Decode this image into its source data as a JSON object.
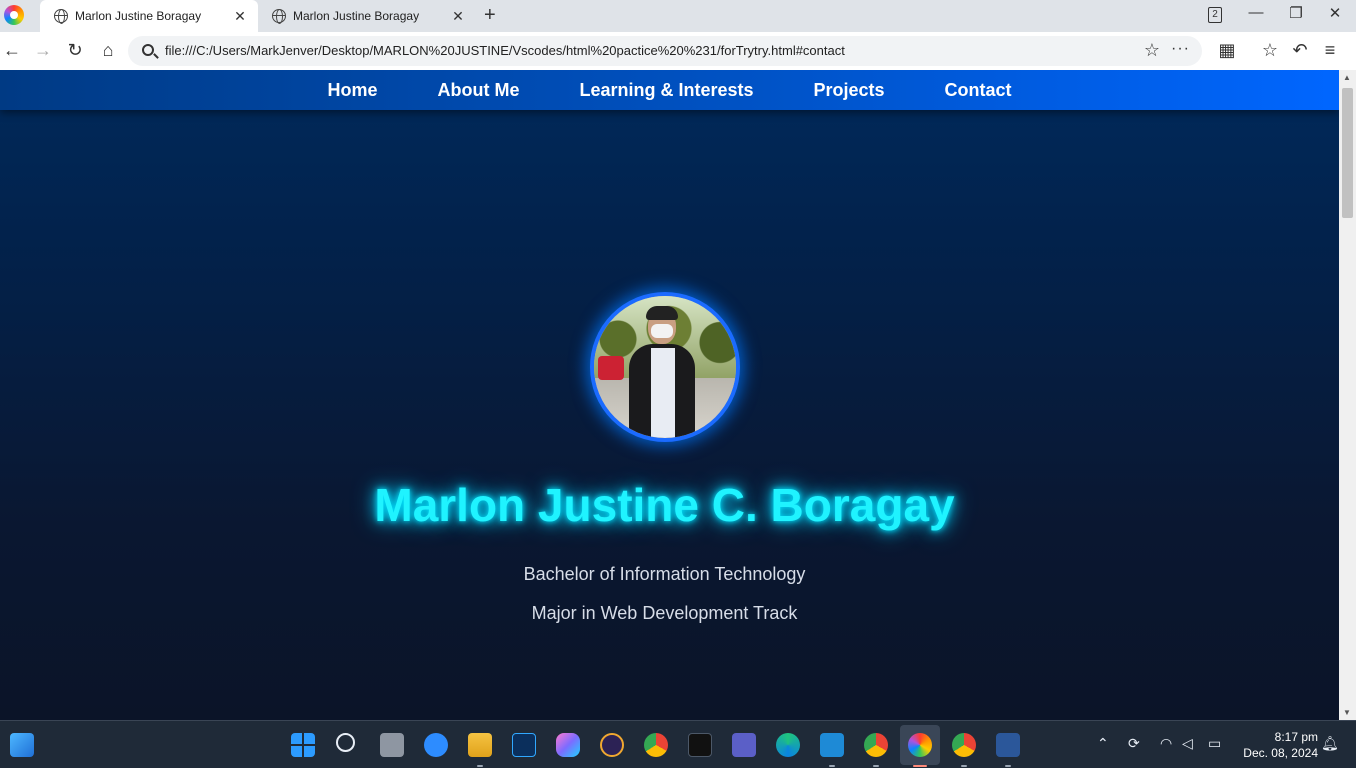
{
  "browser": {
    "tabs": [
      {
        "title": "Marlon Justine Boragay",
        "active": true
      },
      {
        "title": "Marlon Justine Boragay",
        "active": false
      }
    ],
    "tab_count": "2",
    "url": "file:///C:/Users/MarkJenver/Desktop/MARLON%20JUSTINE/Vscodes/html%20pactice%20%231/forTrytry.html#contact",
    "icons": {
      "back": "←",
      "forward": "→",
      "reload": "↻",
      "home": "⌂",
      "star": "☆",
      "more": "···",
      "newtab": "+",
      "close": "✕",
      "minimize": "—",
      "restore": "❐",
      "window_close": "✕",
      "extensions": "▦",
      "favorites": "☆",
      "history": "↶",
      "menu": "≡"
    }
  },
  "site": {
    "nav": [
      "Home",
      "About Me",
      "Learning & Interests",
      "Projects",
      "Contact"
    ],
    "name": "Marlon Justine C. Boragay",
    "degree": "Bachelor of Information Technology",
    "major": "Major in Web Development Track"
  },
  "taskbar": {
    "time": "8:17 pm",
    "date": "Dec. 08, 2024",
    "colors": {
      "accent": "#0066ff",
      "glow": "#1ff3ff"
    }
  }
}
